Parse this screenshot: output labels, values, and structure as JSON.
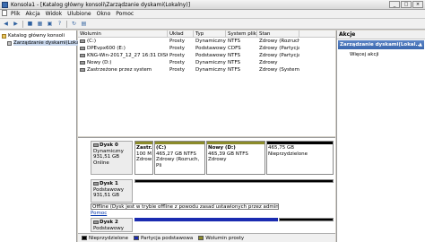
{
  "window": {
    "title": "Konsola1 - [Katalog główny konsoli\\Zarządzanie dyskami(Lokalny)]",
    "buttons": [
      "_",
      "□",
      "×"
    ]
  },
  "menu": [
    {
      "label": "Plik"
    },
    {
      "label": "Akcja"
    },
    {
      "label": "Widok"
    },
    {
      "label": "Ulubione"
    },
    {
      "label": "Okno"
    },
    {
      "label": "Pomoc"
    }
  ],
  "toolbar": {
    "icons": [
      "back-icon",
      "forward-icon",
      "up-icon",
      "console-tree-icon",
      "properties-icon",
      "help-icon",
      "refresh-icon",
      "export-icon"
    ]
  },
  "tree": {
    "root": "Katalog główny konsoli",
    "child": "Zarządzanie dyskami(Lokalny)"
  },
  "volumes": {
    "headers": [
      "Wolumin",
      "Układ",
      "Typ",
      "System plików",
      "Stan"
    ],
    "rows": [
      {
        "name": "(C:)",
        "layout": "Prosty",
        "type": "Dynamiczny",
        "fs": "NTFS",
        "status": "Zdrowy (Rozruch, Plik stron"
      },
      {
        "name": "DPEvpx600 (E:)",
        "layout": "Prosty",
        "type": "Podstawowy",
        "fs": "CDFS",
        "status": "Zdrowy (Partycja podstaw"
      },
      {
        "name": "KNG-Win-2017_12_27 16:31 DISK_01",
        "layout": "Prosty",
        "type": "Podstawowy",
        "fs": "NTFS",
        "status": "Zdrowy (Partycja podstaw"
      },
      {
        "name": "Nowy (D:)",
        "layout": "Prosty",
        "type": "Dynamiczny",
        "fs": "NTFS",
        "status": "Zdrowy"
      },
      {
        "name": "Zastrzeżone przez system",
        "layout": "Prosty",
        "type": "Dynamiczny",
        "fs": "NTFS",
        "status": "Zdrowy (System)"
      }
    ]
  },
  "disks": {
    "disk0": {
      "name": "Dysk 0",
      "kind": "Dynamiczny",
      "size": "931,51 GB",
      "state": "Online",
      "parts": [
        {
          "label": "Zastr.",
          "line2": "100 M",
          "line3": "Zdrow"
        },
        {
          "label": "(C:)",
          "line2": "465,27 GB NTFS",
          "line3": "Zdrowy (Rozruch, Pli"
        },
        {
          "label": "Nowy (D:)",
          "line2": "465,39 GB NTFS",
          "line3": "Zdrowy"
        },
        {
          "label": "",
          "line2": "465,75 GB",
          "line3": "Nieprzydzielone"
        }
      ]
    },
    "disk1": {
      "name": "Dysk 1",
      "kind": "Podstawowy",
      "size": "931,51 GB",
      "state": "Offline",
      "tooltip": "Offline (Dysk jest w trybie offline z powodu zasad ustawionych przez administratora)",
      "help": "Pomoc"
    },
    "disk2": {
      "name": "Dysk 2",
      "kind": "Podstawowy"
    }
  },
  "legend": [
    {
      "label": "Nieprzydzielone",
      "color": "#000000"
    },
    {
      "label": "Partycja podstawowa",
      "color": "#1a2bb0"
    },
    {
      "label": "Wolumin prosty",
      "color": "#8b8b2a"
    }
  ],
  "actions": {
    "title": "Akcje",
    "section": "Zarządzanie dyskami(Lokal...",
    "more": "Więcej akcji"
  },
  "colors": {
    "dynamic_stripe": "#8b8b2a",
    "basic_stripe": "#1a2bb0",
    "unallocated_stripe": "#000000"
  }
}
